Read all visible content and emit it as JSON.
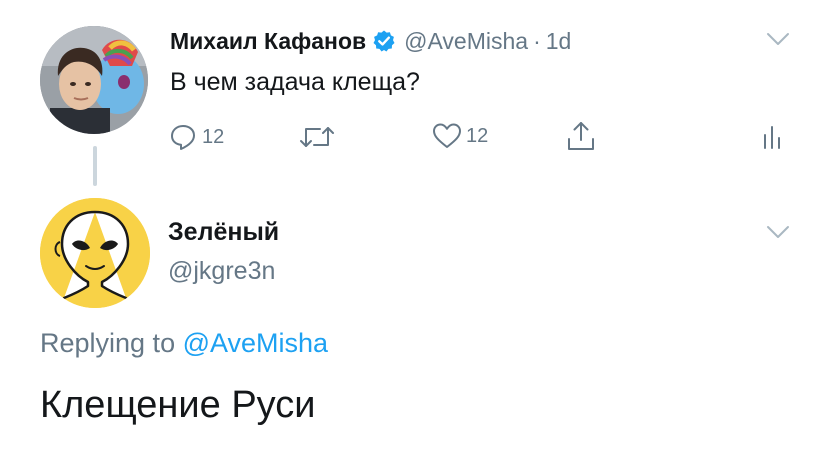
{
  "parent_tweet": {
    "author_name": "Михаил Кафанов",
    "handle": "@AveMisha",
    "separator": "·",
    "time": "1d",
    "text": "В чем задача клеща?",
    "replies_count": "12",
    "likes_count": "12",
    "icons": {
      "verified": "verified-badge-icon",
      "reply": "reply-icon",
      "retweet": "retweet-icon",
      "like": "heart-icon",
      "share": "share-icon",
      "stats": "analytics-icon",
      "menu": "chevron-down-icon"
    }
  },
  "reply_tweet": {
    "author_name": "Зелёный",
    "handle": "@jkgre3n",
    "replying_prefix": "Replying to",
    "replying_to": "@AveMisha",
    "text": "Клещение Руси",
    "icons": {
      "menu": "chevron-down-icon"
    }
  },
  "colors": {
    "text": "#14171a",
    "secondary": "#657786",
    "link": "#1da1f2",
    "thread_line": "#ccd6dd",
    "avatar2_background": "#f8d247"
  }
}
